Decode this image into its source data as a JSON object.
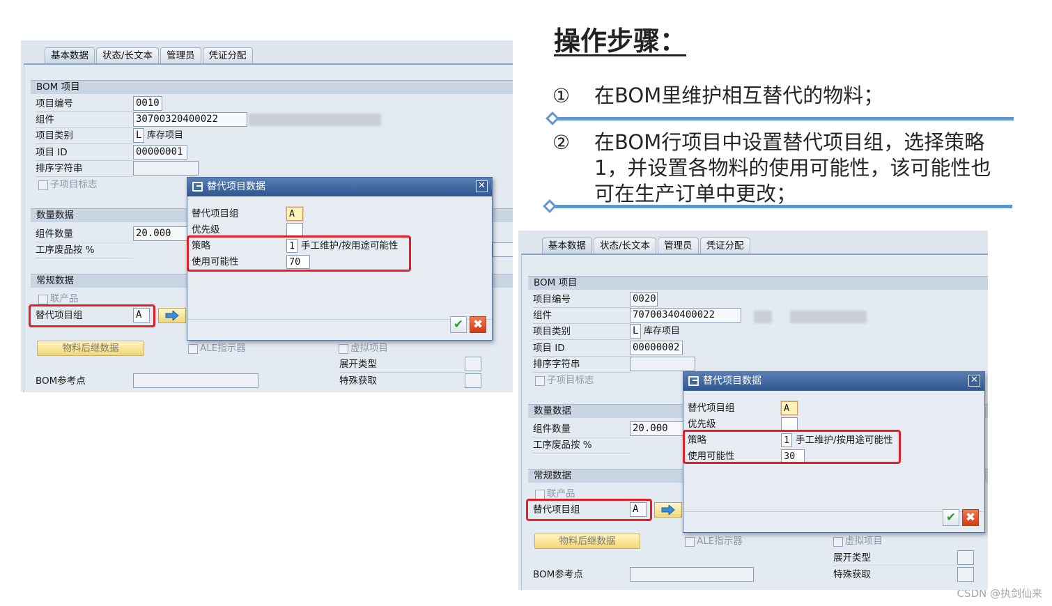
{
  "heading": "操作步骤：",
  "steps": [
    {
      "num": "①",
      "text": "在BOM里维护相互替代的物料；"
    },
    {
      "num": "②",
      "text": "在BOM行项目中设置替代项目组，选择策略1，并设置各物料的使用可能性，该可能性也可在生产订单中更改；"
    }
  ],
  "watermark": "CSDN @执剑仙来",
  "tabs": [
    "基本数据",
    "状态/长文本",
    "管理员",
    "凭证分配"
  ],
  "labels": {
    "bom_group": "BOM 项目",
    "item_no": "项目编号",
    "component": "组件",
    "item_cat": "项目类别",
    "item_id": "项目 ID",
    "sort_string": "排序字符串",
    "sub_item_flag": "子项目标志",
    "qty_group": "数量数据",
    "comp_qty": "组件数量",
    "scrap": "工序废品按 %",
    "general_group": "常规数据",
    "co_product": "联产品",
    "alt_group": "替代项目组",
    "followup_btn": "物料后继数据",
    "ale": "ALE指示器",
    "phantom": "虚拟项目",
    "explosion_type": "展开类型",
    "special_proc": "特殊获取",
    "bom_ref": "BOM参考点"
  },
  "dialog": {
    "title": "替代项目数据",
    "alt_group_label": "替代项目组",
    "priority_label": "优先级",
    "strategy_label": "策略",
    "usage_label": "使用可能性",
    "strategy_desc": "手工维护/按用途可能性",
    "ok": "✔",
    "cancel": "✖",
    "close": "✕"
  },
  "screen1": {
    "item_no": "0010",
    "component": "30700320400022",
    "item_cat": "L",
    "item_cat_desc": "库存项目",
    "item_id": "00000001",
    "comp_qty": "20.000",
    "alt_group": "A",
    "dlg_alt_group": "A",
    "dlg_strategy": "1",
    "dlg_usage": "70"
  },
  "screen2": {
    "item_no": "0020",
    "component": "70700340400022",
    "item_cat": "L",
    "item_cat_desc": "库存项目",
    "item_id": "00000002",
    "comp_qty": "20.000",
    "alt_group": "A",
    "dlg_alt_group": "A",
    "dlg_strategy": "1",
    "dlg_usage": "30"
  }
}
